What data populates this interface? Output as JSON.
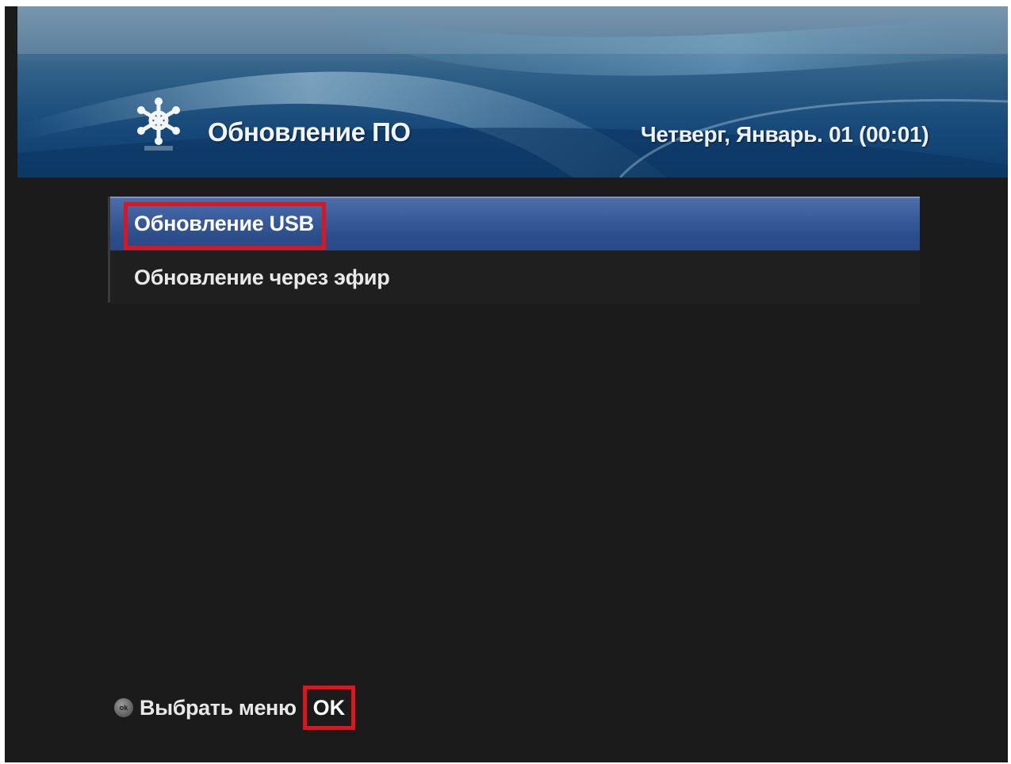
{
  "header": {
    "title": "Обновление ПО",
    "datetime": "Четверг, Январь. 01 (00:01)",
    "icon": "asterisk-settings-icon"
  },
  "menu": {
    "items": [
      {
        "label": "Обновление USB",
        "selected": true,
        "highlighted": true
      },
      {
        "label": "Обновление через эфир",
        "selected": false
      }
    ]
  },
  "footer": {
    "button_icon_label": "ok",
    "hint_label": "Выбрать меню",
    "key_label": "OK"
  },
  "colors": {
    "background": "#1b1b1b",
    "header_blue": "#16497a",
    "selection_blue": "#3d5f9e",
    "annotation_red": "#e0141c"
  }
}
